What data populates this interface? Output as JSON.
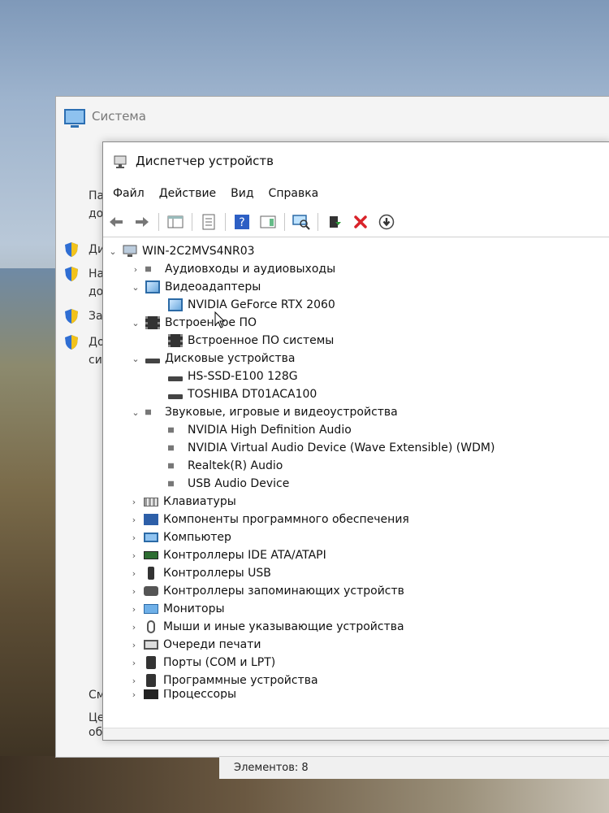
{
  "system_window": {
    "title": "Система",
    "left_text_1": "Па",
    "left_text_2": "до",
    "items": [
      "Ди",
      "На",
      "до",
      "За",
      "До",
      "си"
    ],
    "bottom_text_1": "См",
    "bottom_text_2": "Це",
    "bottom_text_3": "об"
  },
  "device_manager": {
    "title": "Диспетчер устройств",
    "menu": [
      "Файл",
      "Действие",
      "Вид",
      "Справка"
    ],
    "root": "WIN-2C2MVS4NR03",
    "tree": [
      {
        "label": "Аудиовходы и аудиовыходы",
        "level": 1,
        "expanded": false,
        "icon": "speaker-icon"
      },
      {
        "label": "Видеоадаптеры",
        "level": 1,
        "expanded": true,
        "icon": "display-adapter-icon"
      },
      {
        "label": "NVIDIA GeForce RTX 2060",
        "level": 2,
        "icon": "display-adapter-icon"
      },
      {
        "label": "Встроенное ПО",
        "level": 1,
        "expanded": true,
        "icon": "firmware-icon"
      },
      {
        "label": "Встроенное ПО системы",
        "level": 2,
        "icon": "firmware-icon"
      },
      {
        "label": "Дисковые устройства",
        "level": 1,
        "expanded": true,
        "icon": "disk-icon"
      },
      {
        "label": "HS-SSD-E100 128G",
        "level": 2,
        "icon": "disk-icon"
      },
      {
        "label": "TOSHIBA DT01ACA100",
        "level": 2,
        "icon": "disk-icon"
      },
      {
        "label": "Звуковые, игровые и видеоустройства",
        "level": 1,
        "expanded": true,
        "icon": "speaker-icon"
      },
      {
        "label": "NVIDIA High Definition Audio",
        "level": 2,
        "icon": "speaker-icon"
      },
      {
        "label": "NVIDIA Virtual Audio Device (Wave Extensible) (WDM)",
        "level": 2,
        "icon": "speaker-icon"
      },
      {
        "label": "Realtek(R) Audio",
        "level": 2,
        "icon": "speaker-icon"
      },
      {
        "label": "USB Audio Device",
        "level": 2,
        "icon": "speaker-icon"
      },
      {
        "label": "Клавиатуры",
        "level": 1,
        "expanded": false,
        "icon": "keyboard-icon"
      },
      {
        "label": "Компоненты программного обеспечения",
        "level": 1,
        "expanded": false,
        "icon": "software-component-icon"
      },
      {
        "label": "Компьютер",
        "level": 1,
        "expanded": false,
        "icon": "computer-icon"
      },
      {
        "label": "Контроллеры IDE ATA/ATAPI",
        "level": 1,
        "expanded": false,
        "icon": "ide-controller-icon"
      },
      {
        "label": "Контроллеры USB",
        "level": 1,
        "expanded": false,
        "icon": "usb-icon"
      },
      {
        "label": "Контроллеры запоминающих устройств",
        "level": 1,
        "expanded": false,
        "icon": "storage-controller-icon"
      },
      {
        "label": "Мониторы",
        "level": 1,
        "expanded": false,
        "icon": "monitor-icon"
      },
      {
        "label": "Мыши и иные указывающие устройства",
        "level": 1,
        "expanded": false,
        "icon": "mouse-icon"
      },
      {
        "label": "Очереди печати",
        "level": 1,
        "expanded": false,
        "icon": "printer-icon"
      },
      {
        "label": "Порты (COM и LPT)",
        "level": 1,
        "expanded": false,
        "icon": "port-icon"
      },
      {
        "label": "Программные устройства",
        "level": 1,
        "expanded": false,
        "icon": "software-device-icon"
      },
      {
        "label": "Процессоры",
        "level": 1,
        "expanded": false,
        "icon": "processor-icon"
      }
    ]
  },
  "statusbar": {
    "text": "Элементов: 8"
  },
  "colors": {
    "accent": "#2b6aa6",
    "delete_red": "#d9232a",
    "enable_green": "#2e9b3a"
  }
}
